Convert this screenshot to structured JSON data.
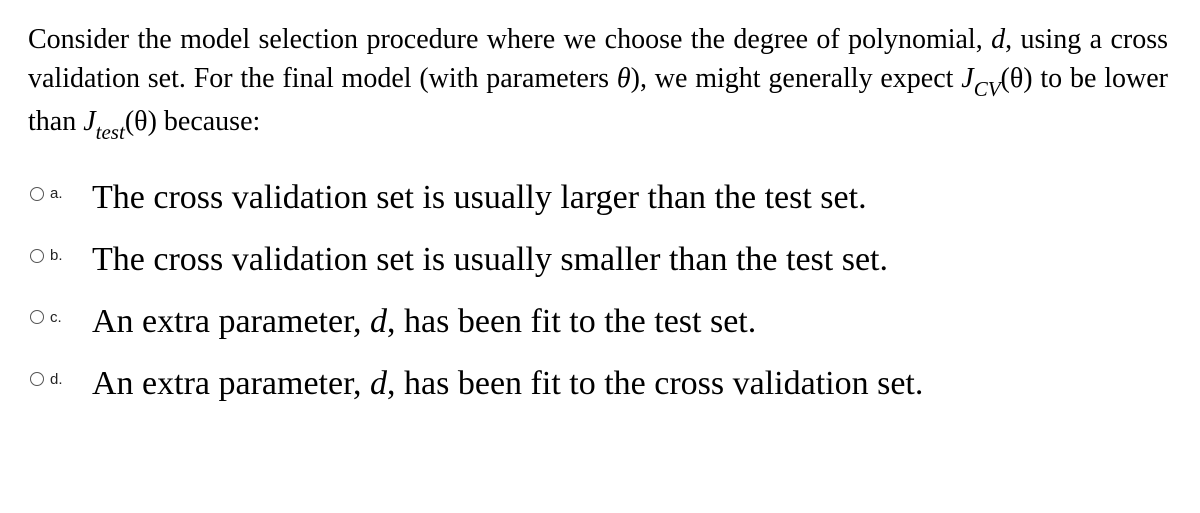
{
  "question": {
    "stem_prefix": "Consider the model selection procedure where we choose the degree of polynomial, ",
    "stem_var_d": "d",
    "stem_mid1": ", using a cross validation set. For the final model (with parameters ",
    "stem_theta": "θ",
    "stem_mid2": "), we might generally expect ",
    "stem_Jcv_J": "J",
    "stem_Jcv_sub": "CV",
    "stem_Jcv_arg": "(θ)",
    "stem_mid3": " to be lower than ",
    "stem_Jtest_J": "J",
    "stem_Jtest_sub": "test",
    "stem_Jtest_arg": "(θ)",
    "stem_suffix": " because:"
  },
  "options": [
    {
      "key": "a.",
      "text_prefix": "The cross validation set is usually larger than the test set.",
      "has_d": false
    },
    {
      "key": "b.",
      "text_prefix": "The cross validation set is usually smaller than the test set.",
      "has_d": false
    },
    {
      "key": "c.",
      "text_prefix": "An extra parameter, ",
      "d": "d",
      "text_suffix": ", has been fit to the test set.",
      "has_d": true
    },
    {
      "key": "d.",
      "text_prefix": "An extra parameter, ",
      "d": "d",
      "text_suffix": ", has been fit to the cross validation set.",
      "has_d": true
    }
  ]
}
